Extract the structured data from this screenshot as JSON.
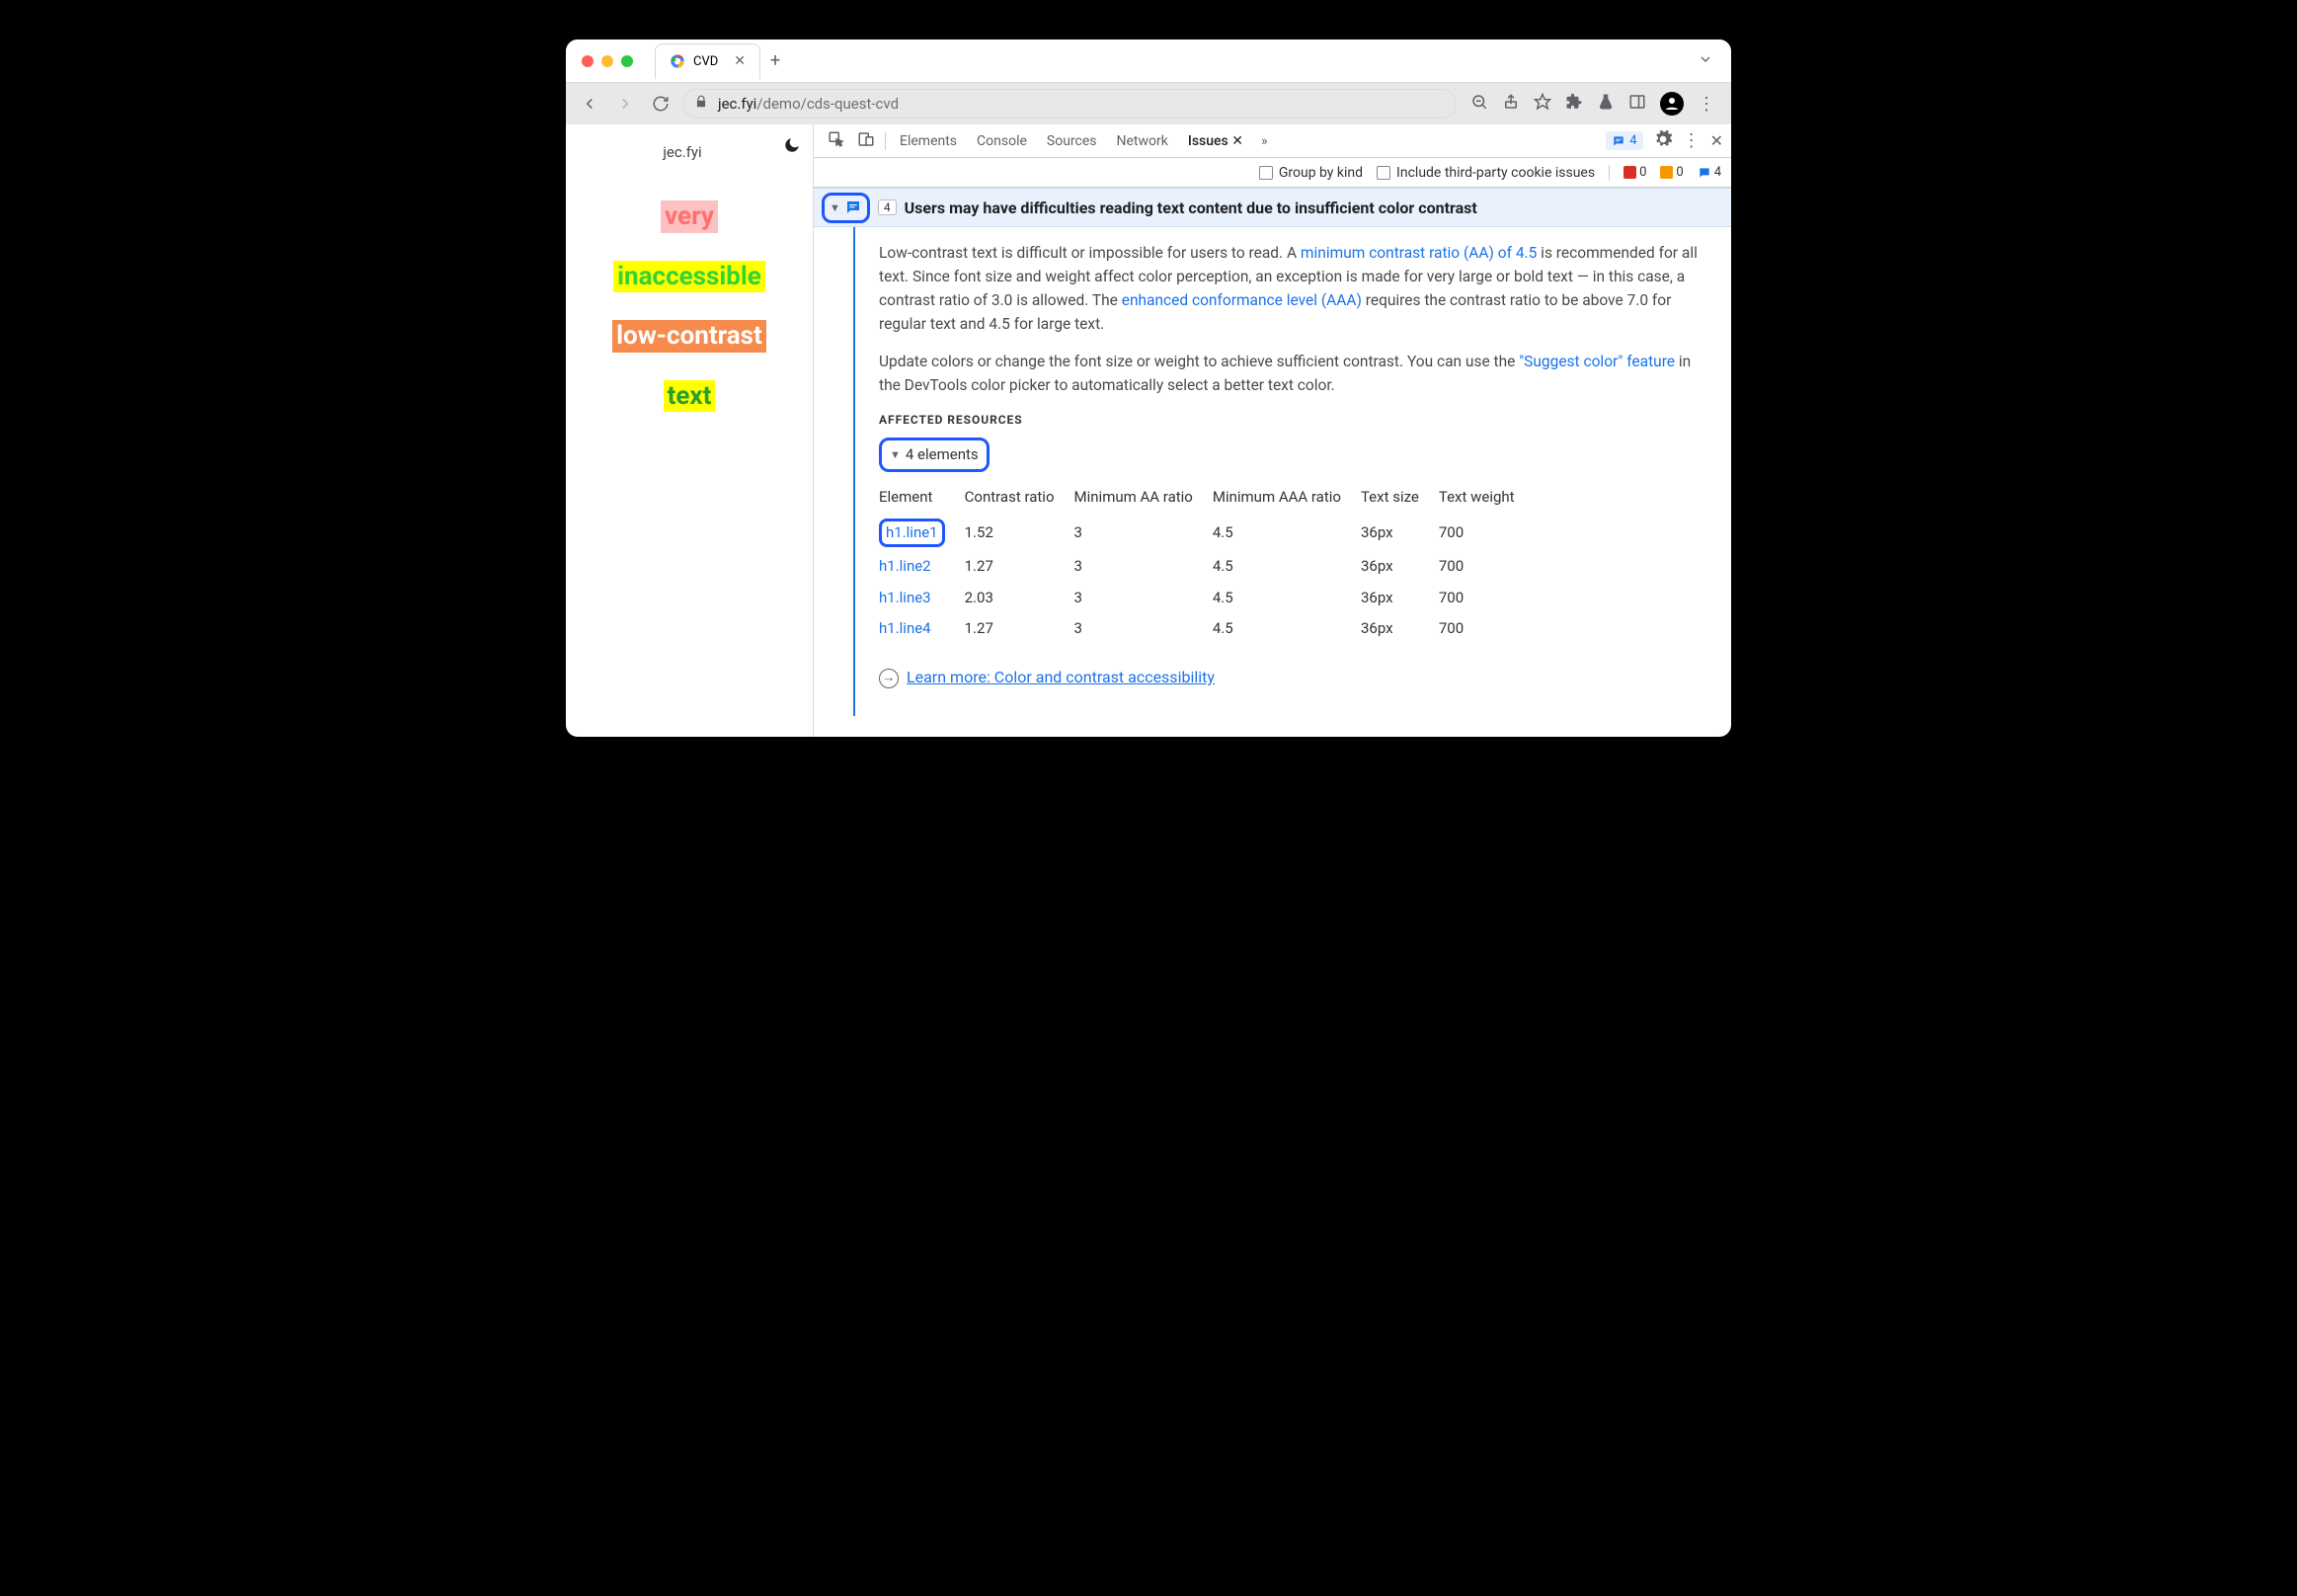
{
  "browser": {
    "tab_title": "CVD",
    "url_host": "jec.fyi",
    "url_path": "/demo/cds-quest-cvd"
  },
  "page": {
    "site_label": "jec.fyi",
    "samples": [
      "very",
      "inaccessible",
      "low-contrast",
      "text"
    ]
  },
  "devtools": {
    "tabs": [
      "Elements",
      "Console",
      "Sources",
      "Network",
      "Issues"
    ],
    "active_tab": "Issues",
    "badge_count": "4",
    "subbar": {
      "group_by_kind": "Group by kind",
      "third_party": "Include third-party cookie issues",
      "counter_red": "0",
      "counter_orange": "0",
      "counter_blue": "4"
    }
  },
  "issue": {
    "count": "4",
    "title": "Users may have difficulties reading text content due to insufficient color contrast",
    "p1_a": "Low-contrast text is difficult or impossible for users to read. A ",
    "p1_link": "minimum contrast ratio (AA) of 4.5",
    "p1_b": " is recommended for all text. Since font size and weight affect color perception, an exception is made for very large or bold text — in this case, a contrast ratio of 3.0 is allowed. The ",
    "p1_link2": "enhanced conformance level (AAA)",
    "p1_c": " requires the contrast ratio to be above 7.0 for regular text and 4.5 for large text.",
    "p2_a": "Update colors or change the font size or weight to achieve sufficient contrast. You can use the ",
    "p2_link": "\"Suggest color\" feature",
    "p2_b": " in the DevTools color picker to automatically select a better text color.",
    "affected_label": "AFFECTED RESOURCES",
    "elements_toggle": "4 elements",
    "columns": [
      "Element",
      "Contrast ratio",
      "Minimum AA ratio",
      "Minimum AAA ratio",
      "Text size",
      "Text weight"
    ],
    "rows": [
      {
        "el": "h1.line1",
        "cr": "1.52",
        "aa": "3",
        "aaa": "4.5",
        "size": "36px",
        "weight": "700"
      },
      {
        "el": "h1.line2",
        "cr": "1.27",
        "aa": "3",
        "aaa": "4.5",
        "size": "36px",
        "weight": "700"
      },
      {
        "el": "h1.line3",
        "cr": "2.03",
        "aa": "3",
        "aaa": "4.5",
        "size": "36px",
        "weight": "700"
      },
      {
        "el": "h1.line4",
        "cr": "1.27",
        "aa": "3",
        "aaa": "4.5",
        "size": "36px",
        "weight": "700"
      }
    ],
    "learn_more": "Learn more: Color and contrast accessibility"
  }
}
